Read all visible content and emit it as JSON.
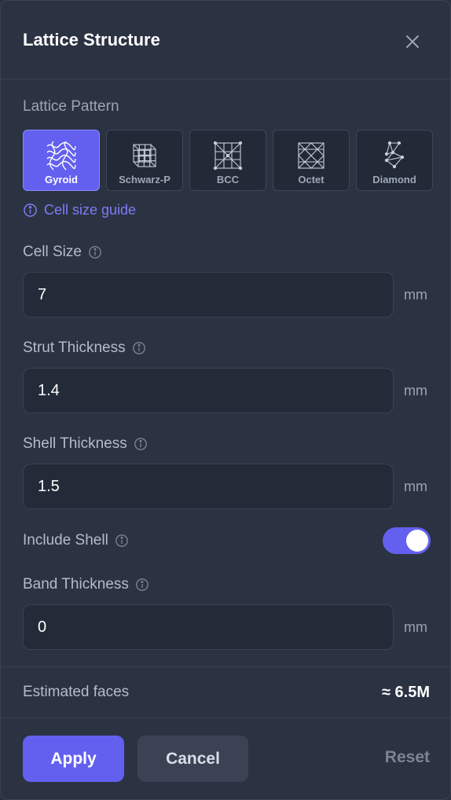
{
  "dialog": {
    "title": "Lattice Structure",
    "close_icon": "close-icon"
  },
  "pattern_section": {
    "label": "Lattice Pattern",
    "options": [
      {
        "label": "Gyroid",
        "icon": "gyroid-icon",
        "selected": true
      },
      {
        "label": "Schwarz-P",
        "icon": "schwarz-p-icon",
        "selected": false
      },
      {
        "label": "BCC",
        "icon": "bcc-icon",
        "selected": false
      },
      {
        "label": "Octet",
        "icon": "octet-icon",
        "selected": false
      },
      {
        "label": "Diamond",
        "icon": "diamond-icon",
        "selected": false
      }
    ],
    "guide_link": "Cell size guide"
  },
  "fields": {
    "cell_size": {
      "label": "Cell Size",
      "value": "7",
      "unit": "mm"
    },
    "strut_thickness": {
      "label": "Strut Thickness",
      "value": "1.4",
      "unit": "mm"
    },
    "shell_thickness": {
      "label": "Shell Thickness",
      "value": "1.5",
      "unit": "mm"
    },
    "include_shell": {
      "label": "Include Shell",
      "on": true
    },
    "band_thickness": {
      "label": "Band Thickness",
      "value": "0",
      "unit": "mm"
    }
  },
  "estimate": {
    "label": "Estimated faces",
    "value": "≈ 6.5M"
  },
  "actions": {
    "apply": "Apply",
    "cancel": "Cancel",
    "reset": "Reset"
  },
  "colors": {
    "accent": "#6360f0",
    "panel": "#2b3242",
    "input_bg": "#232a38"
  }
}
